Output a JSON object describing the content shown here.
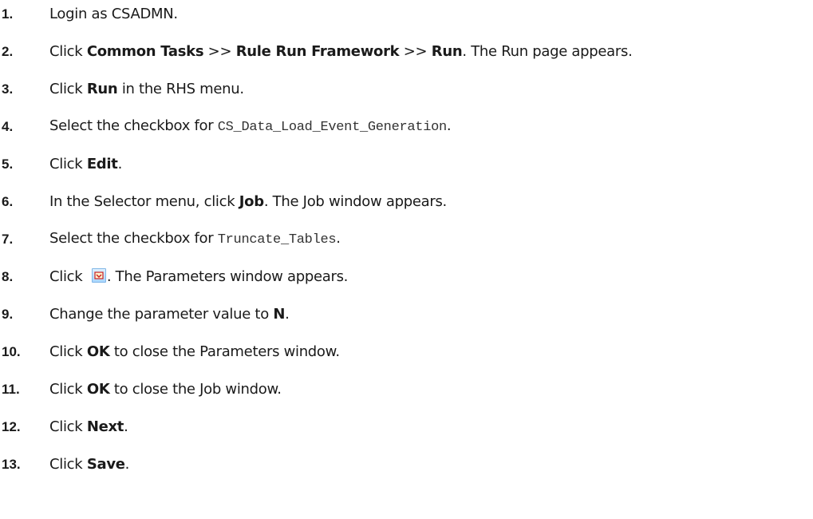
{
  "steps": [
    {
      "num": "1.",
      "parts": [
        "Login as CSADMN."
      ]
    },
    {
      "num": "2.",
      "parts": [
        "Click ",
        "Common Tasks",
        " >> ",
        "Rule Run Framework",
        " >> ",
        "Run",
        ". The Run page appears."
      ]
    },
    {
      "num": "3.",
      "parts": [
        "Click ",
        "Run",
        " in the RHS menu."
      ]
    },
    {
      "num": "4.",
      "parts": [
        "Select the checkbox for ",
        "CS_Data_Load_Event_Generation",
        "."
      ]
    },
    {
      "num": "5.",
      "parts": [
        "Click ",
        "Edit",
        "."
      ]
    },
    {
      "num": "6.",
      "parts": [
        "In the Selector menu, click ",
        "Job",
        ". The Job window appears."
      ]
    },
    {
      "num": "7.",
      "parts": [
        "Select the checkbox for ",
        "Truncate_Tables",
        "."
      ]
    },
    {
      "num": "8.",
      "parts": [
        "Click ",
        ". The Parameters window appears."
      ],
      "icon": "parameters-icon"
    },
    {
      "num": "9.",
      "parts": [
        "Change the parameter value to ",
        "N",
        "."
      ]
    },
    {
      "num": "10.",
      "parts": [
        "Click ",
        "OK",
        " to close the Parameters window."
      ]
    },
    {
      "num": "11.",
      "parts": [
        "Click ",
        "OK",
        " to close the Job window."
      ]
    },
    {
      "num": "12.",
      "parts": [
        "Click ",
        "Next",
        "."
      ]
    },
    {
      "num": "13.",
      "parts": [
        "Click ",
        "Save",
        "."
      ]
    }
  ],
  "colors": {
    "text": "#1a1a1a",
    "icon_fill": "#a9d6ff",
    "icon_border": "#7fb6e6",
    "icon_glyph": "#cc2222"
  }
}
